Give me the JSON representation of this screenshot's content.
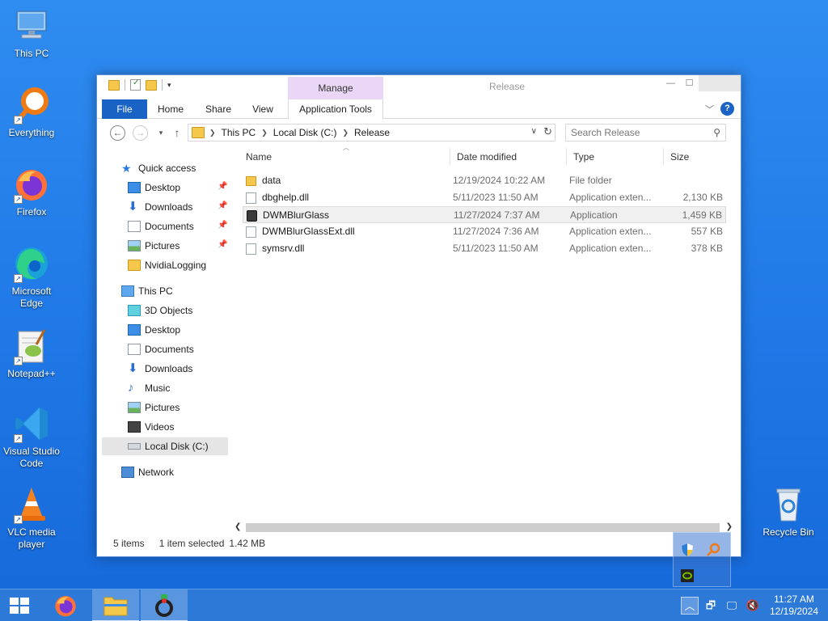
{
  "desktop": {
    "icons": [
      {
        "label": "This PC"
      },
      {
        "label": "Everything"
      },
      {
        "label": "Firefox"
      },
      {
        "label": "Microsoft Edge"
      },
      {
        "label": "Notepad++"
      },
      {
        "label": "Visual Studio Code"
      },
      {
        "label": "VLC media player"
      },
      {
        "label": "Recycle Bin"
      }
    ]
  },
  "window": {
    "title": "Release",
    "manage_tab": "Manage",
    "ribbon_tabs": [
      "File",
      "Home",
      "Share",
      "View",
      "Application Tools"
    ],
    "address": {
      "crumbs": [
        "This PC",
        "Local Disk (C:)",
        "Release"
      ]
    },
    "search_placeholder": "Search Release",
    "nav": {
      "quick_access": "Quick access",
      "quick_items": [
        "Desktop",
        "Downloads",
        "Documents",
        "Pictures",
        "NvidiaLogging"
      ],
      "this_pc": "This PC",
      "pc_items": [
        "3D Objects",
        "Desktop",
        "Documents",
        "Downloads",
        "Music",
        "Pictures",
        "Videos",
        "Local Disk (C:)"
      ],
      "network": "Network"
    },
    "columns": {
      "name": "Name",
      "date": "Date modified",
      "type": "Type",
      "size": "Size"
    },
    "files": [
      {
        "name": "data",
        "date": "12/19/2024 10:22 AM",
        "type": "File folder",
        "size": ""
      },
      {
        "name": "dbghelp.dll",
        "date": "5/11/2023 11:50 AM",
        "type": "Application exten...",
        "size": "2,130 KB"
      },
      {
        "name": "DWMBlurGlass",
        "date": "11/27/2024 7:37 AM",
        "type": "Application",
        "size": "1,459 KB"
      },
      {
        "name": "DWMBlurGlassExt.dll",
        "date": "11/27/2024 7:36 AM",
        "type": "Application exten...",
        "size": "557 KB"
      },
      {
        "name": "symsrv.dll",
        "date": "5/11/2023 11:50 AM",
        "type": "Application exten...",
        "size": "378 KB"
      }
    ],
    "status": {
      "count": "5 items",
      "selected": "1 item selected",
      "size": "1.42 MB"
    }
  },
  "taskbar": {
    "clock_time": "11:27 AM",
    "clock_date": "12/19/2024"
  },
  "colors": {
    "accent": "#1a63c5",
    "desktop": "#1f78e6",
    "manage": "#ead7f5"
  }
}
